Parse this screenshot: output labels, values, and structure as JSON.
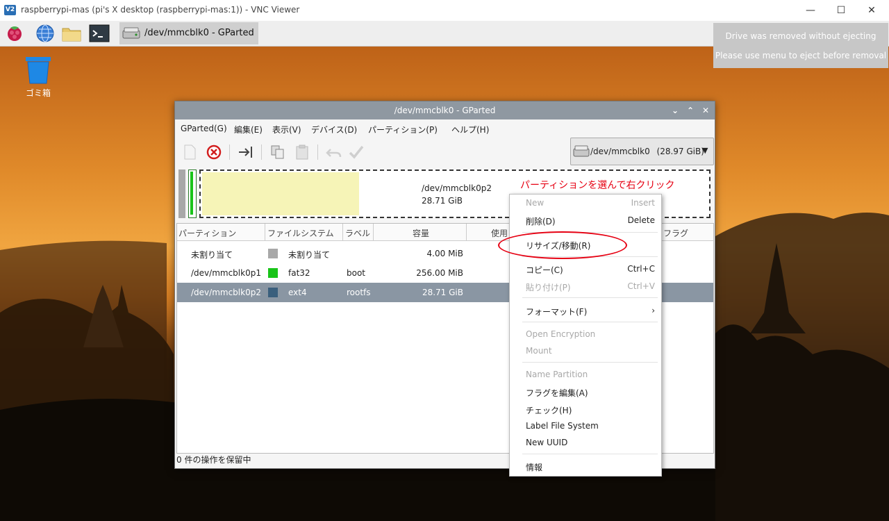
{
  "vnc": {
    "logo": "V2",
    "title": "raspberrypi-mas (pi's X desktop (raspberrypi-mas:1)) - VNC Viewer",
    "minimize_icon": "minimize-icon",
    "maximize_icon": "maximize-icon",
    "close_icon": "close-icon"
  },
  "taskbar": {
    "icons": [
      "raspberry-menu-icon",
      "web-browser-icon",
      "file-manager-icon",
      "terminal-icon"
    ],
    "task_label": "/dev/mmcblk0 - GParted"
  },
  "notification": {
    "line1": "Drive was removed without ejecting",
    "line2": "Please use menu to eject before removal"
  },
  "desktop": {
    "trash_label": "ゴミ箱"
  },
  "gparted": {
    "title": "/dev/mmcblk0 - GParted",
    "menus": [
      "GParted(G)",
      "編集(E)",
      "表示(V)",
      "デバイス(D)",
      "パーティション(P)",
      "ヘルプ(H)"
    ],
    "device": "/dev/mmcblk0",
    "device_size": "(28.97 GiB)",
    "map": {
      "selected_name": "/dev/mmcblk0p2",
      "selected_size": "28.71 GiB",
      "ext4_used_fraction": 0.31
    },
    "annotation": "パーティションを選んで右クリック",
    "columns": [
      "パーティション",
      "ファイルシステム",
      "ラベル",
      "容量",
      "使用",
      "フラグ"
    ],
    "rows": [
      {
        "partition": "未割り当て",
        "fs": "未割り当て",
        "fs_color": "#a8a8a8",
        "label": "",
        "size": "4.00 MiB"
      },
      {
        "partition": "/dev/mmcblk0p1",
        "fs": "fat32",
        "fs_color": "#19c419",
        "label": "boot",
        "size": "256.00 MiB"
      },
      {
        "partition": "/dev/mmcblk0p2",
        "fs": "ext4",
        "fs_color": "#3a5f7d",
        "label": "rootfs",
        "size": "28.71 GiB"
      }
    ],
    "status": "0 件の操作を保留中"
  },
  "context_menu": {
    "new": {
      "label": "New",
      "shortcut": "Insert"
    },
    "delete": {
      "label": "削除(D)",
      "shortcut": "Delete"
    },
    "resize": {
      "label": "リサイズ/移動(R)"
    },
    "copy": {
      "label": "コピー(C)",
      "shortcut": "Ctrl+C"
    },
    "paste": {
      "label": "貼り付け(P)",
      "shortcut": "Ctrl+V"
    },
    "format": {
      "label": "フォーマット(F)",
      "submenu": "›"
    },
    "open_encryption": {
      "label": "Open Encryption"
    },
    "mount": {
      "label": "Mount"
    },
    "name_partition": {
      "label": "Name Partition"
    },
    "edit_flags": {
      "label": "フラグを編集(A)"
    },
    "check": {
      "label": "チェック(H)"
    },
    "label_fs": {
      "label": "Label File System"
    },
    "new_uuid": {
      "label": "New UUID"
    },
    "info": {
      "label": "情報"
    }
  },
  "colors": {
    "annotation": "#e60012",
    "selected_row": "#8a96a3",
    "window_title": "#8f98a1"
  }
}
